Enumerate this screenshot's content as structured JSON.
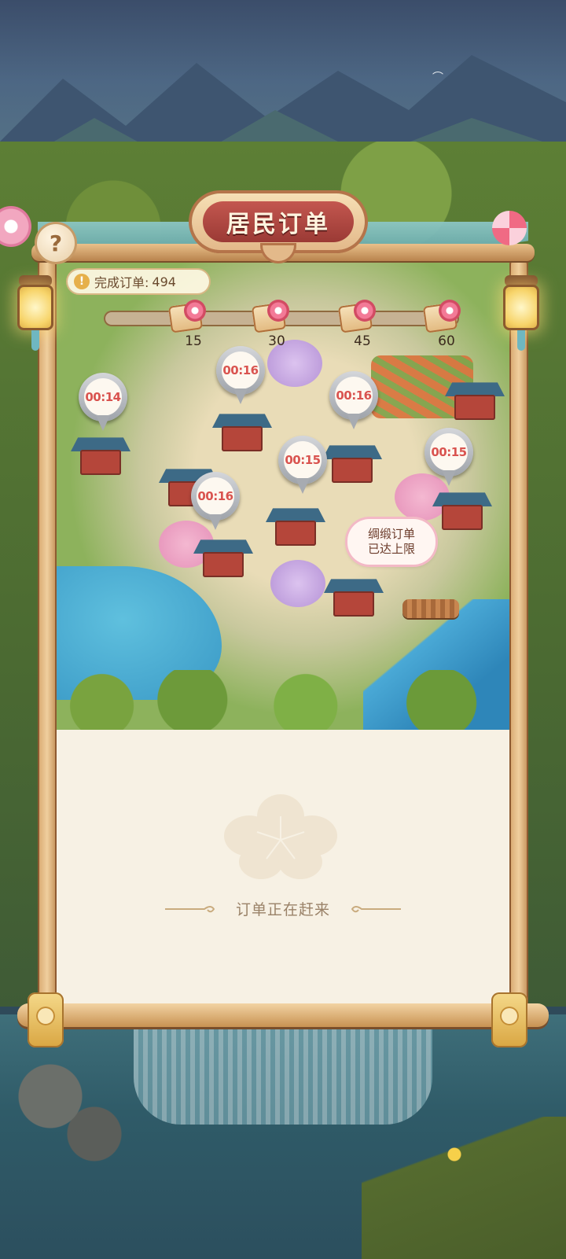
{
  "title": "居民订单",
  "completed_orders": {
    "label": "完成订单:",
    "value": "494"
  },
  "progress": {
    "fill_fraction": 0.0,
    "milestones": [
      {
        "label": "15"
      },
      {
        "label": "30"
      },
      {
        "label": "45"
      },
      {
        "label": "60"
      }
    ]
  },
  "timers": [
    "00:14",
    "00:16",
    "00:16",
    "00:15",
    "00:15",
    "00:16"
  ],
  "silk_notice": {
    "line1": "绸缎订单",
    "line2": "已达上限"
  },
  "panel_message": "订单正在赶来",
  "icons": {
    "help": "question-mark-icon",
    "warning": "exclamation-icon",
    "gift": "gift-box-icon",
    "lantern": "lantern-icon",
    "flower": "plum-blossom-icon"
  },
  "colors": {
    "title_red": "#a9403a",
    "timer_text": "#d9534f",
    "progress_fill": "#f08a3d",
    "panel_bg": "#f7f1e4"
  }
}
